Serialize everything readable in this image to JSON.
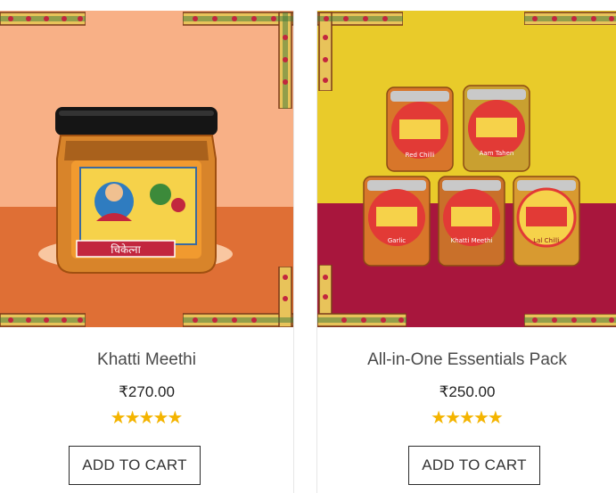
{
  "products": [
    {
      "name": "Khatti Meethi",
      "price": "₹270.00",
      "rating": 5,
      "rating_max": 5,
      "cart_label": "ADD TO CART",
      "jar_label": "चिकेत्ना",
      "colors": {
        "bg_top": "#f8b086",
        "bg_bottom": "#df6f35"
      }
    },
    {
      "name": "All-in-One Essentials Pack",
      "price": "₹250.00",
      "rating": 5,
      "rating_max": 5,
      "cart_label": "ADD TO CART",
      "jar_labels": [
        "Red Chilli",
        "Aam Tahen",
        "Garlic",
        "Khatti Meethi",
        "Lal Chilli"
      ],
      "colors": {
        "bg_top": "#e9cb2a",
        "bg_bottom": "#a8163d"
      }
    }
  ],
  "colors": {
    "star": "#f4b400",
    "text": "#4a4a4a",
    "button_border": "#2b2b2b"
  }
}
